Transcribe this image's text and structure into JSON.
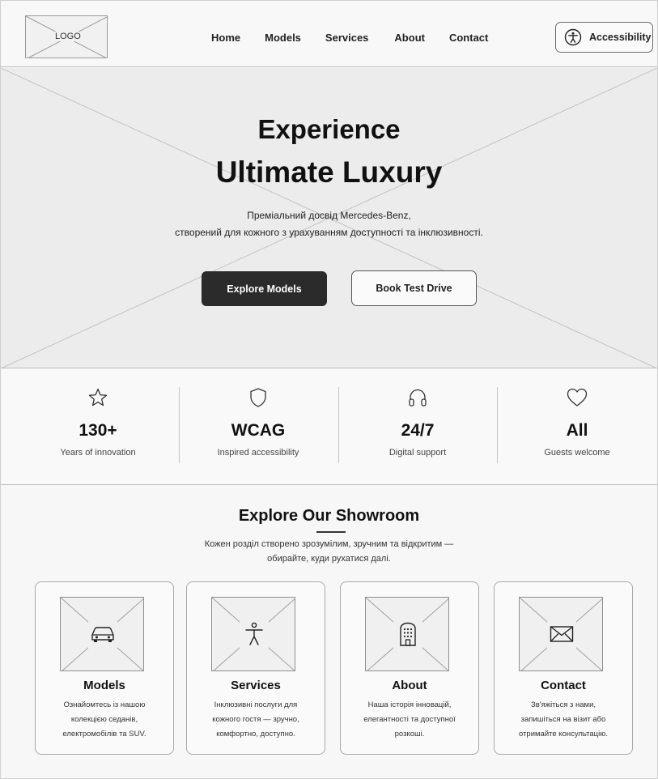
{
  "header": {
    "logo_text": "LOGO",
    "nav": [
      "Home",
      "Models",
      "Services",
      "About",
      "Contact"
    ],
    "accessibility_label": "Accessibility"
  },
  "hero": {
    "title_line1": "Experience",
    "title_line2": "Ultimate Luxury",
    "subtitle_line1": "Преміальний досвід Mercedes-Benz,",
    "subtitle_line2": "створений для кожного з урахуванням доступності та інклюзивності.",
    "primary_button": "Explore Models",
    "secondary_button": "Book Test Drive"
  },
  "stats": [
    {
      "icon": "star-icon",
      "value": "130+",
      "label": "Years of innovation"
    },
    {
      "icon": "shield-icon",
      "value": "WCAG",
      "label": "Inspired accessibility"
    },
    {
      "icon": "headphones-icon",
      "value": "24/7",
      "label": "Digital support"
    },
    {
      "icon": "heart-icon",
      "value": "All",
      "label": "Guests welcome"
    }
  ],
  "showroom": {
    "title": "Explore Our Showroom",
    "description_line1": "Кожен розділ створено зрозумілим, зручним та відкритим —",
    "description_line2": "обирайте, куди рухатися далі.",
    "cards": [
      {
        "icon": "car-icon",
        "title": "Models",
        "lines": [
          "Ознайомтесь із нашою",
          "колекцією седанів,",
          "електромобілів та SUV."
        ]
      },
      {
        "icon": "person-icon",
        "title": "Services",
        "lines": [
          "Інклюзивні послуги для",
          "кожного гостя — зручно,",
          "комфортно, доступно."
        ]
      },
      {
        "icon": "building-icon",
        "title": "About",
        "lines": [
          "Наша історія інновацій,",
          "елегантності та доступної",
          "розкоші."
        ]
      },
      {
        "icon": "envelope-icon",
        "title": "Contact",
        "lines": [
          "Зв'яжіться з нами,",
          "запишіться на візит або",
          "отримайте консультацію."
        ]
      }
    ]
  },
  "colors": {
    "primary_button_bg": "#2b2b2b",
    "placeholder_bg": "#ececec",
    "border": "#bdbdbd"
  }
}
